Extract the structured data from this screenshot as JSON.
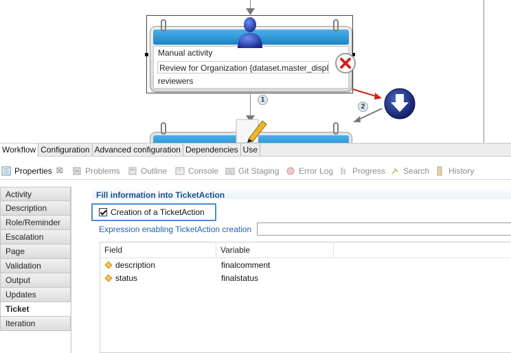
{
  "diagram": {
    "activity": {
      "type_label": "Manual activity",
      "description": "Review for Organization {dataset.master_displa",
      "actor": "reviewers"
    },
    "transition_numbers": [
      "1",
      "2"
    ],
    "colors": {
      "header": "#1c84c6",
      "delete_badge": "#d42020",
      "download_badge": "#1b2f86"
    },
    "icons": [
      "user-icon",
      "delete-x-icon",
      "download-arrow-icon",
      "pencil-icon"
    ]
  },
  "editor_tabs": [
    {
      "label": "Workflow",
      "active": true
    },
    {
      "label": "Configuration",
      "active": false
    },
    {
      "label": "Advanced configuration",
      "active": false
    },
    {
      "label": "Dependencies",
      "active": false
    },
    {
      "label": "Use",
      "active": false
    }
  ],
  "views": [
    {
      "label": "Properties",
      "icon": "properties-icon",
      "active": true
    },
    {
      "label": "Problems",
      "icon": "problems-icon"
    },
    {
      "label": "Outline",
      "icon": "outline-icon"
    },
    {
      "label": "Console",
      "icon": "console-icon"
    },
    {
      "label": "Git Staging",
      "icon": "git-staging-icon"
    },
    {
      "label": "Error Log",
      "icon": "error-log-icon"
    },
    {
      "label": "Progress",
      "icon": "progress-icon"
    },
    {
      "label": "Search",
      "icon": "search-icon"
    },
    {
      "label": "History",
      "icon": "history-icon"
    }
  ],
  "properties_close": "☒",
  "sidebar": {
    "items": [
      {
        "label": "Activity"
      },
      {
        "label": "Description"
      },
      {
        "label": "Role/Reminder"
      },
      {
        "label": "Escalation"
      },
      {
        "label": "Page"
      },
      {
        "label": "Validation"
      },
      {
        "label": "Output"
      },
      {
        "label": "Updates"
      },
      {
        "label": "Ticket",
        "active": true
      },
      {
        "label": "Iteration"
      }
    ]
  },
  "panel": {
    "section_title": "Fill information into TicketAction",
    "checkbox_label": "Creation of a TicketAction",
    "checkbox_checked": true,
    "expression_link": "Expression enabling TicketAction creation",
    "expression_value": ""
  },
  "table": {
    "columns": [
      "Field",
      "Variable"
    ],
    "rows": [
      {
        "field": "description",
        "variable": "finalcomment"
      },
      {
        "field": "status",
        "variable": "finalstatus"
      }
    ]
  }
}
